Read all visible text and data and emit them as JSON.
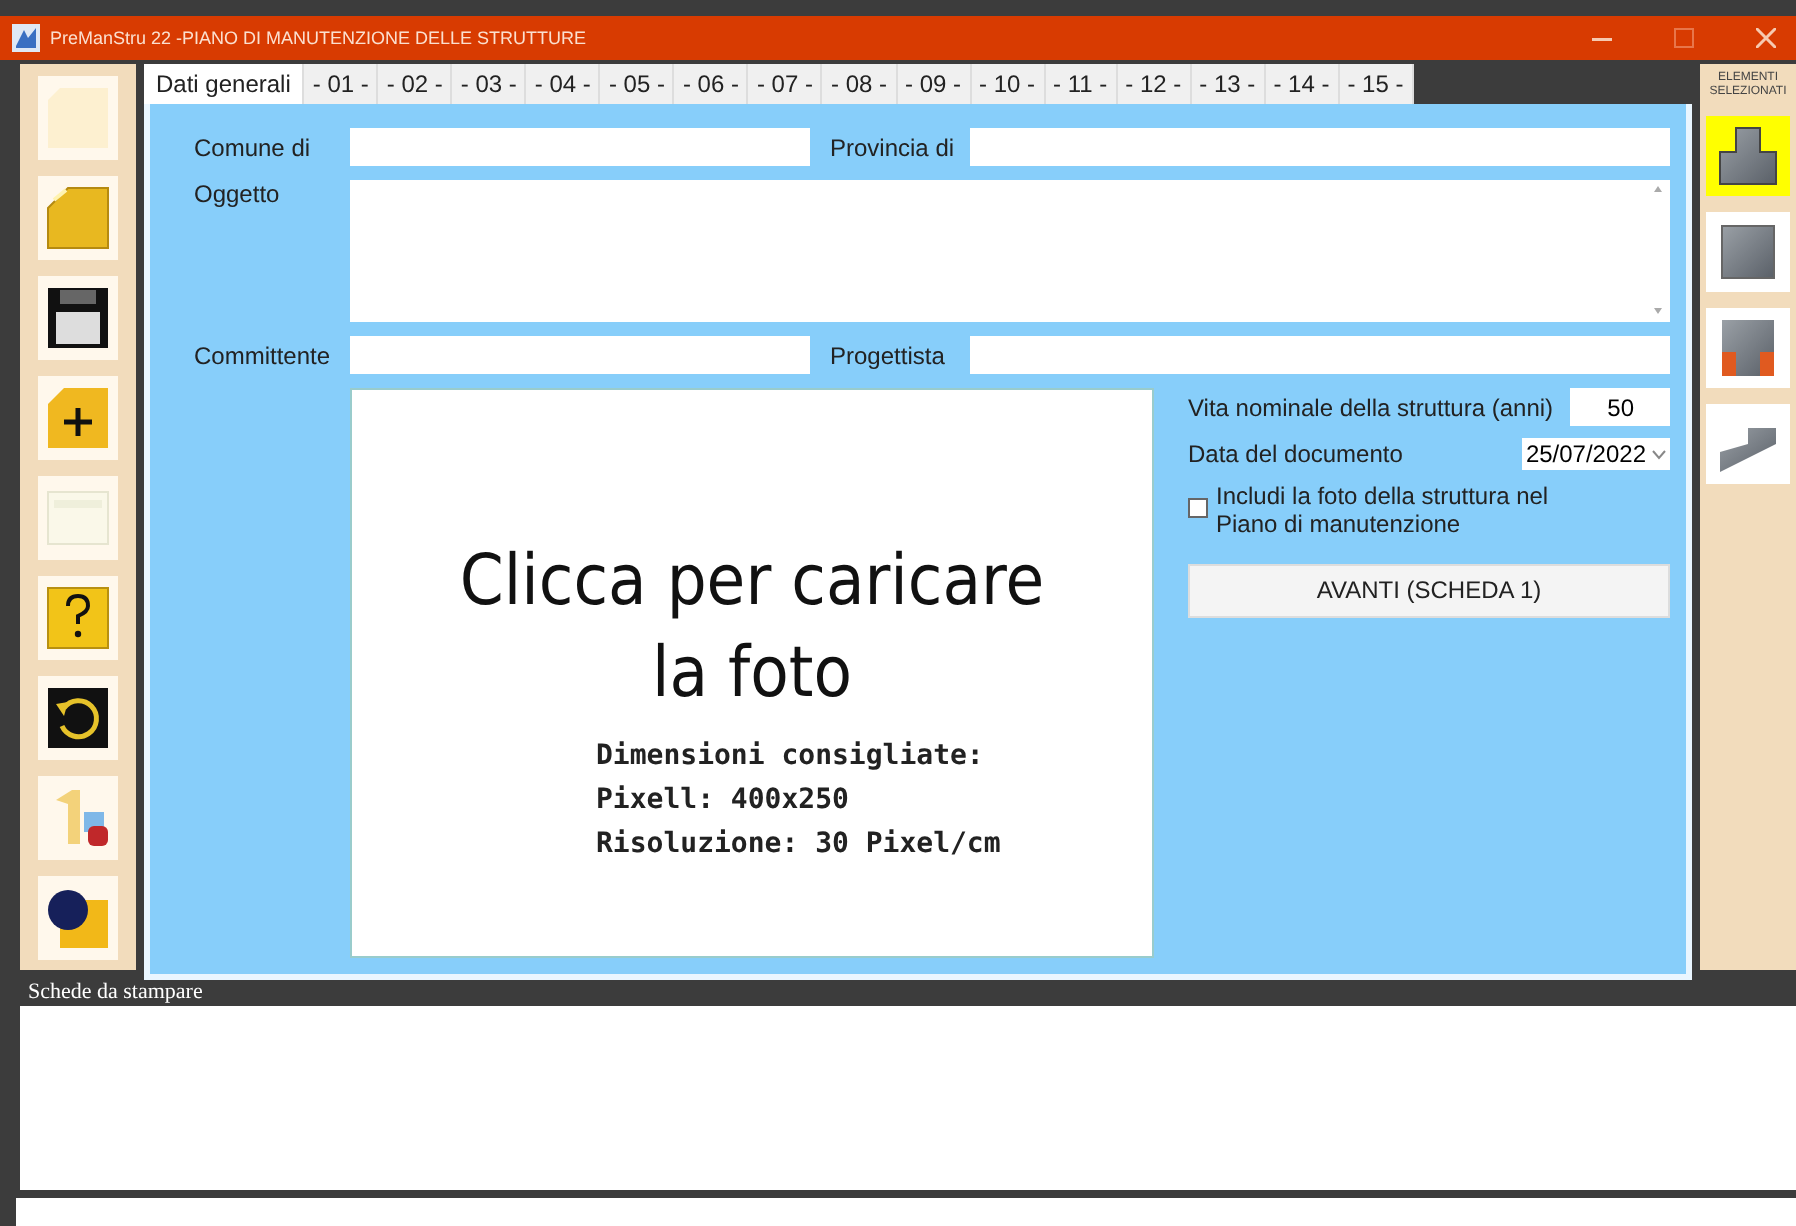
{
  "window": {
    "title": "PreManStru 22 -PIANO DI MANUTENZIONE DELLE STRUTTURE"
  },
  "tabs": [
    {
      "label": "Dati generali",
      "selected": true
    },
    {
      "label": "- 01 -",
      "selected": false
    },
    {
      "label": "- 02 -",
      "selected": false
    },
    {
      "label": "- 03 -",
      "selected": false
    },
    {
      "label": "- 04 -",
      "selected": false
    },
    {
      "label": "- 05 -",
      "selected": false
    },
    {
      "label": "- 06 -",
      "selected": false
    },
    {
      "label": "- 07 -",
      "selected": false
    },
    {
      "label": "- 08 -",
      "selected": false
    },
    {
      "label": "- 09 -",
      "selected": false
    },
    {
      "label": "- 10 -",
      "selected": false
    },
    {
      "label": "- 11 -",
      "selected": false
    },
    {
      "label": "- 12 -",
      "selected": false
    },
    {
      "label": "- 13 -",
      "selected": false
    },
    {
      "label": "- 14 -",
      "selected": false
    },
    {
      "label": "- 15 -",
      "selected": false
    }
  ],
  "toolbar": [
    {
      "kind": "blank",
      "disabled": true
    },
    {
      "kind": "folder",
      "disabled": false
    },
    {
      "kind": "save",
      "disabled": false
    },
    {
      "kind": "new",
      "disabled": false
    },
    {
      "kind": "window",
      "disabled": true
    },
    {
      "kind": "help",
      "disabled": false
    },
    {
      "kind": "undo",
      "disabled": false
    },
    {
      "kind": "number",
      "disabled": false
    },
    {
      "kind": "ball",
      "disabled": false
    }
  ],
  "form": {
    "comune_label": "Comune di",
    "provincia_label": "Provincia di",
    "oggetto_label": "Oggetto",
    "committente_label": "Committente",
    "progettista_label": "Progettista",
    "photo": {
      "lines": [
        "Clicca per caricare",
        "la foto"
      ],
      "hints": [
        "Dimensioni consigliate:",
        "Pixell: 400x250",
        "Risoluzione: 30 Pixel/cm"
      ]
    },
    "vita_label": "Vita nominale della struttura (anni)",
    "vita_value": "50",
    "data_label": "Data del documento",
    "data_value": "25/07/2022",
    "include_photo": {
      "label": "Includi la foto della struttura  nel Piano di manutenzione",
      "checked": false
    },
    "next_button": "AVANTI (SCHEDA 1)"
  },
  "elements": {
    "title": "ELEMENTI SELEZIONATI",
    "items": [
      {
        "kind": "tee",
        "selected": true
      },
      {
        "kind": "square",
        "selected": false
      },
      {
        "kind": "portal",
        "selected": false
      },
      {
        "kind": "ramp",
        "selected": false
      }
    ]
  },
  "print_panel": {
    "title": "Schede da stampare"
  }
}
